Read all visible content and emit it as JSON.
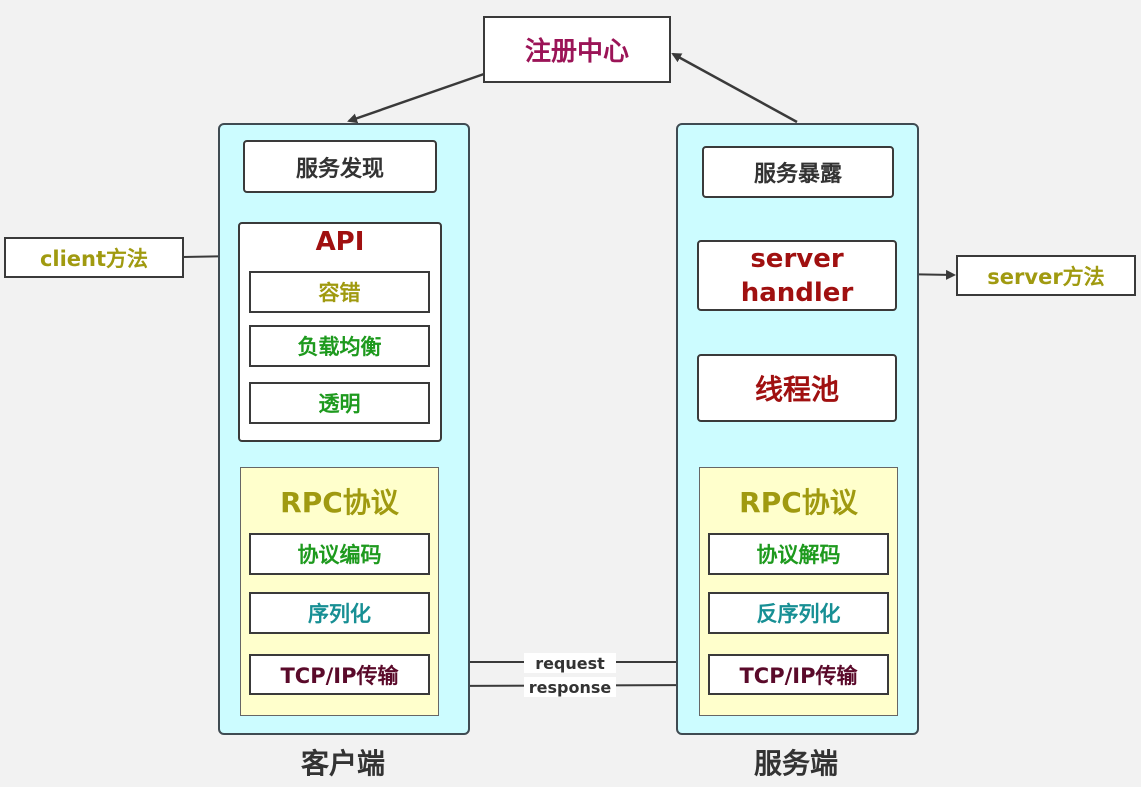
{
  "registry": {
    "label": "注册中心",
    "color": "#9b1457"
  },
  "client": {
    "title": "客户端",
    "discovery": "服务发现",
    "api": {
      "title": "API",
      "items": [
        "容错",
        "负载均衡",
        "透明"
      ]
    },
    "rpc": {
      "title": "RPC协议",
      "items": [
        "协议编码",
        "序列化",
        "TCP/IP传输"
      ]
    },
    "external": "client方法"
  },
  "server": {
    "title": "服务端",
    "exposure": "服务暴露",
    "handler": "server handler",
    "threadpool": "线程池",
    "rpc": {
      "title": "RPC协议",
      "items": [
        "协议解码",
        "反序列化",
        "TCP/IP传输"
      ]
    },
    "external": "server方法"
  },
  "transport": {
    "request": "request",
    "response": "response"
  },
  "colors": {
    "panel_fill": "#ccfcff",
    "rpc_fill": "#ffffcc",
    "dark_red": "#a01010",
    "olive": "#a09a10",
    "green": "#1e9a1e",
    "teal": "#178f94",
    "maroon": "#5a0a2a",
    "gray_text": "#333333"
  }
}
